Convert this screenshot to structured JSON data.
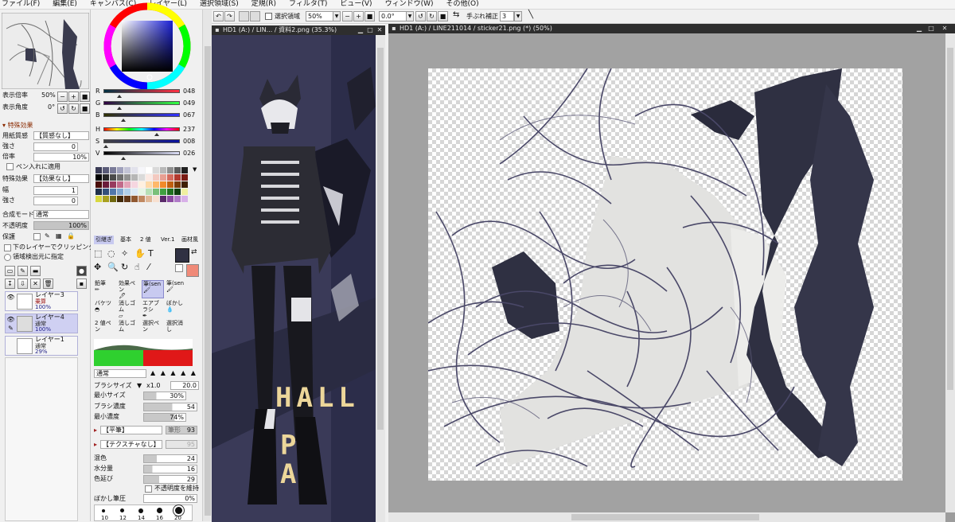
{
  "menu": [
    "ファイル(F)",
    "編集(E)",
    "キャンバス(C)",
    "レイヤー(L)",
    "選択領域(S)",
    "定規(R)",
    "フィルタ(T)",
    "ビュー(V)",
    "ウィンドウ(W)",
    "その他(O)"
  ],
  "toolbar": {
    "selection_label": "選択領域",
    "zoom": "50%",
    "angle": "0.0°",
    "stabilizer_label": "手ぶれ補正",
    "stabilizer_value": "3"
  },
  "navigator": {
    "zoom_label": "表示倍率",
    "zoom_value": "50%",
    "angle_label": "表示角度",
    "angle_value": "0°"
  },
  "effects": {
    "header": "特殊効果",
    "paper_label": "用紙質感",
    "paper_value": "【質感なし】",
    "strength_label": "強さ",
    "strength_value": "0",
    "scale_label": "倍率",
    "scale_value": "10%",
    "pen_apply": "ペン入れに適用",
    "effect_label": "特殊効果",
    "effect_value": "【効果なし】",
    "width_label": "幅",
    "width_value": "1",
    "effect_strength_label": "強さ",
    "effect_strength_value": "0"
  },
  "layer_props": {
    "blend_label": "合成モード",
    "blend_value": "通常",
    "opacity_label": "不透明度",
    "opacity_value": "100%",
    "protect_label": "保護",
    "clip_label": "下のレイヤーでクリッピング",
    "source_label": "領域検出元に指定"
  },
  "layers": [
    {
      "name": "レイヤー3",
      "mode": "乗算",
      "opacity": "100%"
    },
    {
      "name": "レイヤー4",
      "mode": "通常",
      "opacity": "100%"
    },
    {
      "name": "レイヤー1",
      "mode": "通常",
      "opacity": "29%"
    }
  ],
  "color": {
    "rgb": [
      {
        "label": "R",
        "value": "048"
      },
      {
        "label": "G",
        "value": "049"
      },
      {
        "label": "B",
        "value": "067"
      }
    ],
    "hsv": [
      {
        "label": "H",
        "value": "237"
      },
      {
        "label": "S",
        "value": "008"
      },
      {
        "label": "V",
        "value": "026"
      }
    ],
    "current": "#303143"
  },
  "tool_tabs": [
    "引継ぎ",
    "基本",
    "2 値",
    "Ver.1",
    "画材風"
  ],
  "tools": [
    [
      "鉛筆",
      "効果ペン",
      "筆(sen",
      "筆(sen"
    ],
    [
      "バケツ",
      "消しゴム",
      "エアブラシ",
      "ぼかし"
    ],
    [
      "2 値ペン",
      "消しゴム",
      "選択ペン",
      "選択消し"
    ]
  ],
  "brush": {
    "mode_value": "通常",
    "size_label": "ブラシサイズ",
    "size_mult": "x1.0",
    "size_value": "20.0",
    "min_size_label": "最小サイズ",
    "min_size_value": "30%",
    "density_label": "ブラシ濃度",
    "density_value": "54",
    "min_density_label": "最小濃度",
    "min_density_value": "74%",
    "shape_value": "【平筆】",
    "shape_strength_label": "筆形",
    "shape_strength_value": "93",
    "texture_value": "【テクスチャなし】",
    "texture_strength": "95",
    "blend_label": "混色",
    "blend_value": "24",
    "water_label": "水分量",
    "water_value": "16",
    "stretch_label": "色延び",
    "stretch_value": "29",
    "keep_opacity_label": "不透明度を維持",
    "blur_label": "ぼかし筆圧",
    "blur_value": "0%"
  },
  "brush_sizes": [
    "10",
    "12",
    "14",
    "16",
    "20"
  ],
  "window1": {
    "title": "HD1 (A:) / LIN... / 資料2.png (35.3%)",
    "art_text": [
      "HALL",
      "P A"
    ]
  },
  "window2": {
    "title": "HD1 (A:) / LINE211014 / sticker21.png (*) (50%)"
  }
}
